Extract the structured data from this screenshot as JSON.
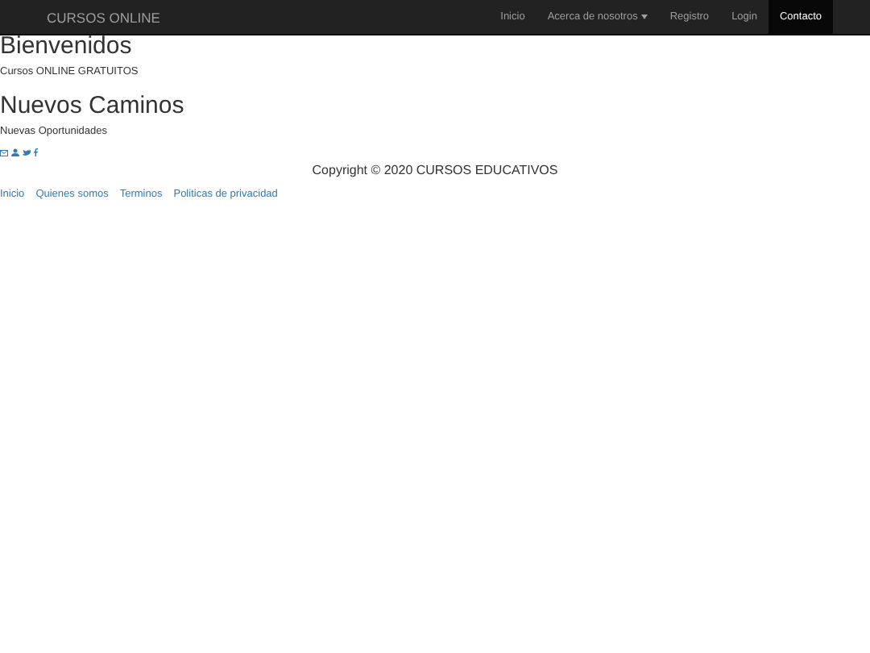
{
  "navbar": {
    "brand": "CURSOS ONLINE",
    "items": [
      {
        "label": "Inicio",
        "selected": false,
        "dropdown": false
      },
      {
        "label": "Acerca de nosotros",
        "selected": false,
        "dropdown": true
      },
      {
        "label": "Registro",
        "selected": false,
        "dropdown": false
      },
      {
        "label": "Login",
        "selected": false,
        "dropdown": false
      },
      {
        "label": "Contacto",
        "selected": true,
        "dropdown": false
      }
    ]
  },
  "sections": [
    {
      "heading": "Bienvenidos",
      "text": "Cursos ONLINE GRATUITOS"
    },
    {
      "heading": "Nuevos Caminos",
      "text": "Nuevas Oportunidades"
    }
  ],
  "social": [
    {
      "kind": "envelope"
    },
    {
      "kind": "person"
    },
    {
      "kind": "bird"
    },
    {
      "kind": "facebook"
    }
  ],
  "copyright": "Copyright © 2020 CURSOS EDUCATIVOS",
  "footer_links": [
    "Inicio",
    "Quienes somos",
    "Terminos",
    "Politicas de privacidad"
  ]
}
